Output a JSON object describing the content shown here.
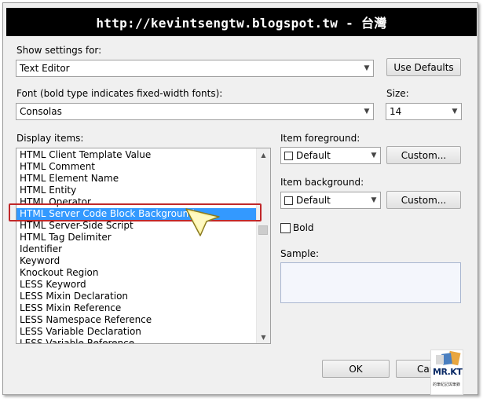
{
  "banner": {
    "text": "http://kevintsengtw.blogspot.tw - 台灣"
  },
  "settings_for": {
    "label": "Show settings for:",
    "value": "Text Editor"
  },
  "buttons": {
    "use_defaults": "Use Defaults",
    "custom_fg": "Custom...",
    "custom_bg": "Custom...",
    "ok": "OK",
    "cancel": "Car"
  },
  "font": {
    "label": "Font (bold type indicates fixed-width fonts):",
    "value": "Consolas"
  },
  "size": {
    "label": "Size:",
    "value": "14"
  },
  "display_items": {
    "label": "Display items:",
    "items": [
      "HTML Client Template Value",
      "HTML Comment",
      "HTML Element Name",
      "HTML Entity",
      "HTML Operator",
      "HTML Server Code Block Background",
      "HTML Server-Side Script",
      "HTML Tag Delimiter",
      "Identifier",
      "Keyword",
      "Knockout Region",
      "LESS Keyword",
      "LESS Mixin Declaration",
      "LESS Mixin Reference",
      "LESS Namespace Reference",
      "LESS Variable Declaration",
      "LESS Variable Reference"
    ],
    "selected_index": 5
  },
  "item_foreground": {
    "label": "Item foreground:",
    "value": "Default"
  },
  "item_background": {
    "label": "Item background:",
    "value": "Default"
  },
  "bold": {
    "label": "Bold",
    "checked": false
  },
  "sample": {
    "label": "Sample:"
  },
  "logo": {
    "text": "MR.KT",
    "sub": "的筆紀記與筆錄"
  },
  "colors": {
    "selection": "#3399ff",
    "highlight_border": "#c0282a",
    "banner_bg": "#000000"
  }
}
